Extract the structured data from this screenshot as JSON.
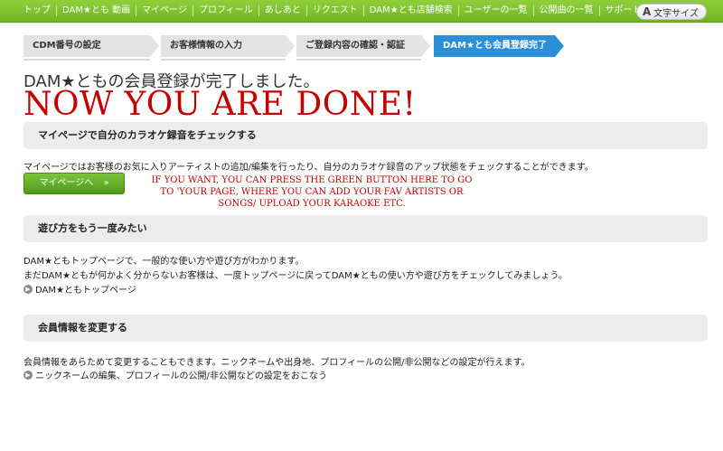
{
  "topnav": {
    "items": [
      "トップ",
      "DAM★とも 動画",
      "マイページ",
      "プロフィール",
      "あしあと",
      "リクエスト",
      "DAM★とも店舗検索",
      "ユーザーの一覧",
      "公開曲の一覧",
      "サポート"
    ],
    "font_size_label": "文字サイズ",
    "font_size_icon_glyph": "A"
  },
  "steps": [
    "CDM番号の設定",
    "お客様情報の入力",
    "ご登録内容の確認・認証",
    "DAM★とも会員登録完了"
  ],
  "complete_message": "DAM★ともの会員登録が完了しました。",
  "overlay_title": "NOW YOU ARE DONE!",
  "sections": {
    "mypage": {
      "heading": "マイページで自分のカラオケ録音をチェックする",
      "text": "マイページではお客様のお気に入りアーティストの追加/編集を行ったり、自分のカラオケ録音のアップ状態をチェックすることができます。",
      "button_label": "マイページへ",
      "button_arrow": "»",
      "note": "IF YOU WANT, YOU CAN PRESS THE GREEN BUTTON HERE TO GO TO 'YOUR PAGE, WHERE YOU CAN ADD YOUR FAV ARTISTS OR SONGS/ UPLOAD YOUR KARAOKE ETC."
    },
    "howto": {
      "heading": "遊び方をもう一度みたい",
      "text1": "DAM★ともトップページで、一般的な使い方や遊び方がわかります。",
      "text2": "まだDAM★ともが何かよく分からないお客様は、一度トップページに戻ってDAM★ともの使い方や遊び方をチェックしてみましょう。",
      "link": "DAM★ともトップページ"
    },
    "member": {
      "heading": "会員情報を変更する",
      "text": "会員情報をあらためて変更することもできます。ニックネームや出身地、プロフィールの公開/非公開などの設定が行えます。",
      "link": "ニックネームの編集、プロフィールの公開/非公開などの設定をおこなう"
    }
  },
  "colors": {
    "nav_green": "#7bc12e",
    "active_step": "#2b8fd8",
    "overlay_red": "#c40000",
    "button_green": "#5fab26"
  },
  "link_icon_glyph": "▶"
}
